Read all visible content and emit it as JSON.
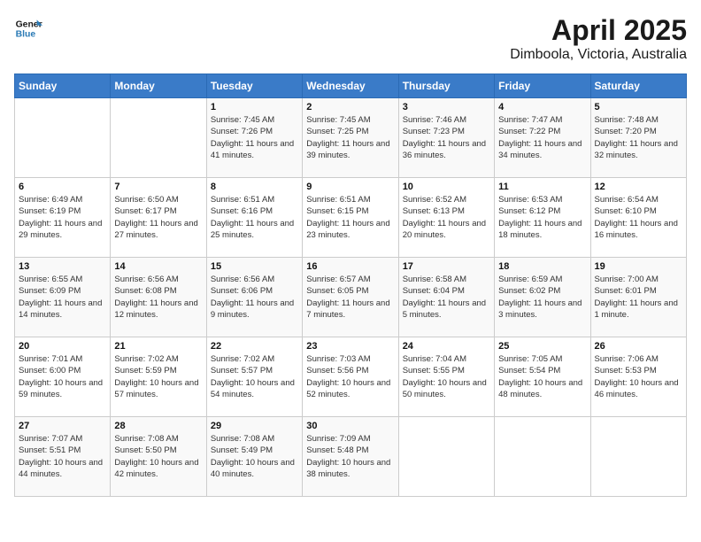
{
  "header": {
    "logo_line1": "General",
    "logo_line2": "Blue",
    "title": "April 2025",
    "subtitle": "Dimboola, Victoria, Australia"
  },
  "weekdays": [
    "Sunday",
    "Monday",
    "Tuesday",
    "Wednesday",
    "Thursday",
    "Friday",
    "Saturday"
  ],
  "weeks": [
    [
      {
        "day": "",
        "info": ""
      },
      {
        "day": "",
        "info": ""
      },
      {
        "day": "1",
        "info": "Sunrise: 7:45 AM\nSunset: 7:26 PM\nDaylight: 11 hours and 41 minutes."
      },
      {
        "day": "2",
        "info": "Sunrise: 7:45 AM\nSunset: 7:25 PM\nDaylight: 11 hours and 39 minutes."
      },
      {
        "day": "3",
        "info": "Sunrise: 7:46 AM\nSunset: 7:23 PM\nDaylight: 11 hours and 36 minutes."
      },
      {
        "day": "4",
        "info": "Sunrise: 7:47 AM\nSunset: 7:22 PM\nDaylight: 11 hours and 34 minutes."
      },
      {
        "day": "5",
        "info": "Sunrise: 7:48 AM\nSunset: 7:20 PM\nDaylight: 11 hours and 32 minutes."
      }
    ],
    [
      {
        "day": "6",
        "info": "Sunrise: 6:49 AM\nSunset: 6:19 PM\nDaylight: 11 hours and 29 minutes."
      },
      {
        "day": "7",
        "info": "Sunrise: 6:50 AM\nSunset: 6:17 PM\nDaylight: 11 hours and 27 minutes."
      },
      {
        "day": "8",
        "info": "Sunrise: 6:51 AM\nSunset: 6:16 PM\nDaylight: 11 hours and 25 minutes."
      },
      {
        "day": "9",
        "info": "Sunrise: 6:51 AM\nSunset: 6:15 PM\nDaylight: 11 hours and 23 minutes."
      },
      {
        "day": "10",
        "info": "Sunrise: 6:52 AM\nSunset: 6:13 PM\nDaylight: 11 hours and 20 minutes."
      },
      {
        "day": "11",
        "info": "Sunrise: 6:53 AM\nSunset: 6:12 PM\nDaylight: 11 hours and 18 minutes."
      },
      {
        "day": "12",
        "info": "Sunrise: 6:54 AM\nSunset: 6:10 PM\nDaylight: 11 hours and 16 minutes."
      }
    ],
    [
      {
        "day": "13",
        "info": "Sunrise: 6:55 AM\nSunset: 6:09 PM\nDaylight: 11 hours and 14 minutes."
      },
      {
        "day": "14",
        "info": "Sunrise: 6:56 AM\nSunset: 6:08 PM\nDaylight: 11 hours and 12 minutes."
      },
      {
        "day": "15",
        "info": "Sunrise: 6:56 AM\nSunset: 6:06 PM\nDaylight: 11 hours and 9 minutes."
      },
      {
        "day": "16",
        "info": "Sunrise: 6:57 AM\nSunset: 6:05 PM\nDaylight: 11 hours and 7 minutes."
      },
      {
        "day": "17",
        "info": "Sunrise: 6:58 AM\nSunset: 6:04 PM\nDaylight: 11 hours and 5 minutes."
      },
      {
        "day": "18",
        "info": "Sunrise: 6:59 AM\nSunset: 6:02 PM\nDaylight: 11 hours and 3 minutes."
      },
      {
        "day": "19",
        "info": "Sunrise: 7:00 AM\nSunset: 6:01 PM\nDaylight: 11 hours and 1 minute."
      }
    ],
    [
      {
        "day": "20",
        "info": "Sunrise: 7:01 AM\nSunset: 6:00 PM\nDaylight: 10 hours and 59 minutes."
      },
      {
        "day": "21",
        "info": "Sunrise: 7:02 AM\nSunset: 5:59 PM\nDaylight: 10 hours and 57 minutes."
      },
      {
        "day": "22",
        "info": "Sunrise: 7:02 AM\nSunset: 5:57 PM\nDaylight: 10 hours and 54 minutes."
      },
      {
        "day": "23",
        "info": "Sunrise: 7:03 AM\nSunset: 5:56 PM\nDaylight: 10 hours and 52 minutes."
      },
      {
        "day": "24",
        "info": "Sunrise: 7:04 AM\nSunset: 5:55 PM\nDaylight: 10 hours and 50 minutes."
      },
      {
        "day": "25",
        "info": "Sunrise: 7:05 AM\nSunset: 5:54 PM\nDaylight: 10 hours and 48 minutes."
      },
      {
        "day": "26",
        "info": "Sunrise: 7:06 AM\nSunset: 5:53 PM\nDaylight: 10 hours and 46 minutes."
      }
    ],
    [
      {
        "day": "27",
        "info": "Sunrise: 7:07 AM\nSunset: 5:51 PM\nDaylight: 10 hours and 44 minutes."
      },
      {
        "day": "28",
        "info": "Sunrise: 7:08 AM\nSunset: 5:50 PM\nDaylight: 10 hours and 42 minutes."
      },
      {
        "day": "29",
        "info": "Sunrise: 7:08 AM\nSunset: 5:49 PM\nDaylight: 10 hours and 40 minutes."
      },
      {
        "day": "30",
        "info": "Sunrise: 7:09 AM\nSunset: 5:48 PM\nDaylight: 10 hours and 38 minutes."
      },
      {
        "day": "",
        "info": ""
      },
      {
        "day": "",
        "info": ""
      },
      {
        "day": "",
        "info": ""
      }
    ]
  ]
}
